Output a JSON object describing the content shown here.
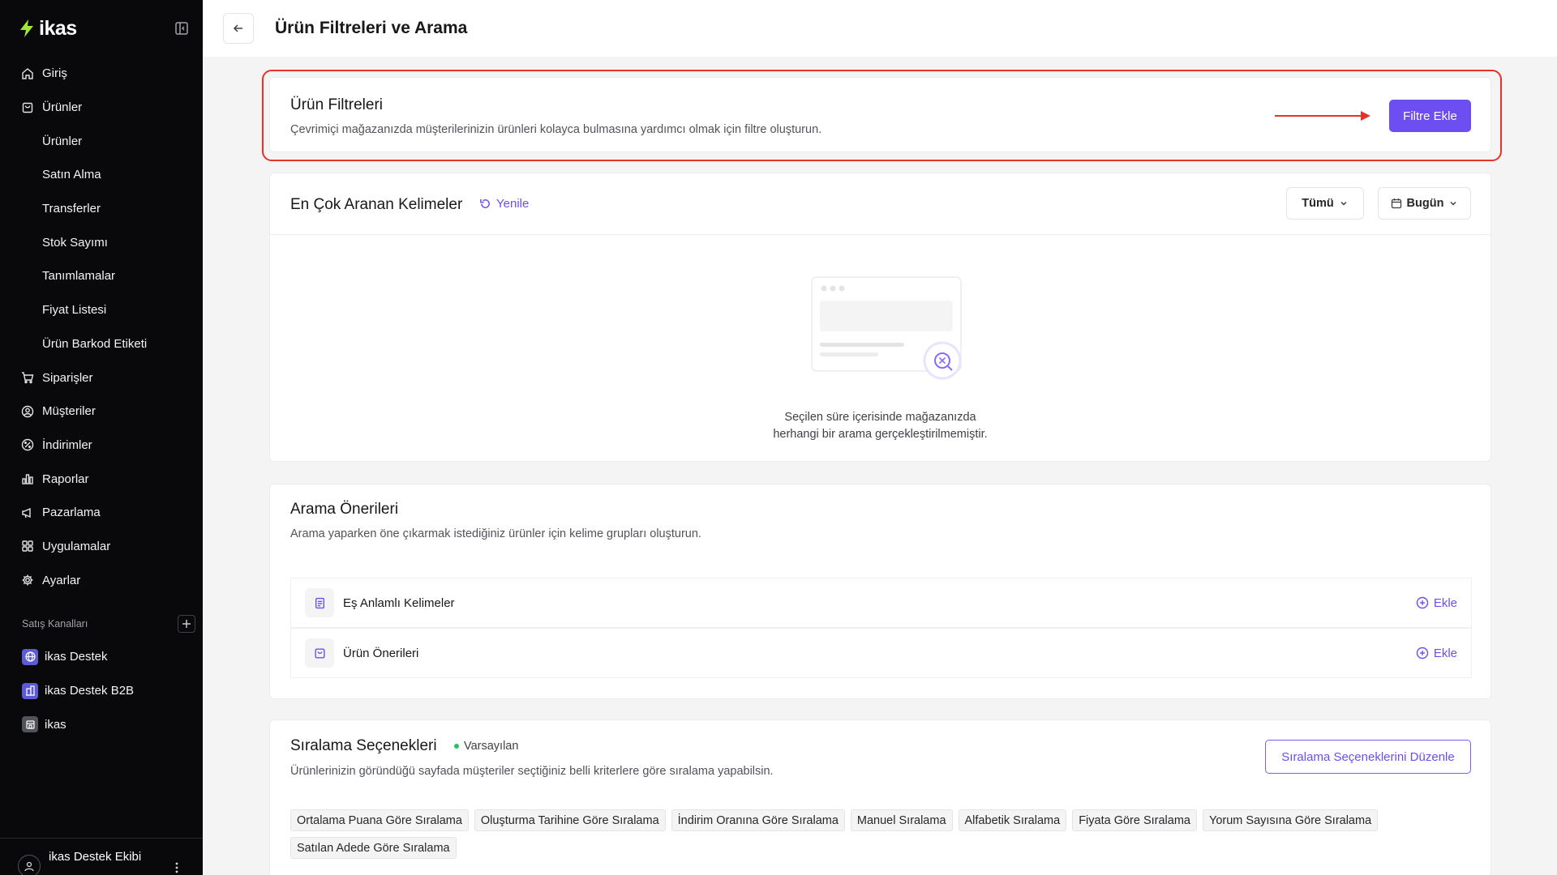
{
  "sidebar": {
    "logo_text": "ikas",
    "nav": [
      {
        "label": "Giriş",
        "icon": "home-icon"
      },
      {
        "label": "Ürünler",
        "icon": "product-bag-icon"
      },
      {
        "label": "Ürünler",
        "sub": true
      },
      {
        "label": "Satın Alma",
        "sub": true
      },
      {
        "label": "Transferler",
        "sub": true
      },
      {
        "label": "Stok Sayımı",
        "sub": true
      },
      {
        "label": "Tanımlamalar",
        "sub": true
      },
      {
        "label": "Fiyat Listesi",
        "sub": true
      },
      {
        "label": "Ürün Barkod Etiketi",
        "sub": true
      },
      {
        "label": "Siparişler",
        "icon": "cart-icon"
      },
      {
        "label": "Müşteriler",
        "icon": "user-circle-icon"
      },
      {
        "label": "İndirimler",
        "icon": "discount-icon"
      },
      {
        "label": "Raporlar",
        "icon": "chart-icon"
      },
      {
        "label": "Pazarlama",
        "icon": "megaphone-icon"
      },
      {
        "label": "Uygulamalar",
        "icon": "apps-grid-icon"
      },
      {
        "label": "Ayarlar",
        "icon": "gear-icon"
      }
    ],
    "sales_channels_label": "Satış Kanalları",
    "channels": [
      {
        "label": "ikas Destek",
        "icon": "globe-icon"
      },
      {
        "label": "ikas Destek B2B",
        "icon": "building-icon"
      },
      {
        "label": "ikas",
        "icon": "store-icon"
      }
    ],
    "user_name": "ikas Destek Ekibi"
  },
  "header": {
    "title": "Ürün Filtreleri ve Arama"
  },
  "filters_card": {
    "title": "Ürün Filtreleri",
    "subtitle": "Çevrimiçi mağazanızda müşterilerinizin ürünleri kolayca bulmasına yardımcı olmak için filtre oluşturun.",
    "button_label": "Filtre Ekle"
  },
  "search_card": {
    "title": "En Çok Aranan Kelimeler",
    "refresh_label": "Yenile",
    "filter_dropdown": "Tümü",
    "date_dropdown": "Bugün",
    "empty_line1": "Seçilen süre içerisinde mağazanızda",
    "empty_line2": "herhangi bir arama gerçekleştirilmemiştir."
  },
  "suggestions_card": {
    "title": "Arama Önerileri",
    "subtitle": "Arama yaparken öne çıkarmak istediğiniz ürünler için kelime grupları oluşturun.",
    "rows": [
      {
        "label": "Eş Anlamlı Kelimeler",
        "action": "Ekle",
        "icon": "document-icon"
      },
      {
        "label": "Ürün Önerileri",
        "action": "Ekle",
        "icon": "product-bag-icon"
      }
    ]
  },
  "sorting_card": {
    "title": "Sıralama Seçenekleri",
    "badge": "Varsayılan",
    "subtitle": "Ürünlerinizin göründüğü sayfada müşteriler seçtiğiniz belli kriterlere göre sıralama yapabilsin.",
    "button_label": "Sıralama Seçeneklerini Düzenle",
    "tags": [
      "Ortalama Puana Göre Sıralama",
      "Oluşturma Tarihine Göre Sıralama",
      "İndirim Oranına Göre Sıralama",
      "Manuel Sıralama",
      "Alfabetik Sıralama",
      "Fiyata Göre Sıralama",
      "Yorum Sayısına Göre Sıralama",
      "Satılan Adede Göre Sıralama"
    ]
  },
  "colors": {
    "accent": "#6d4ef0",
    "highlight": "#e5322b",
    "sidebar_bg": "#09090b"
  }
}
